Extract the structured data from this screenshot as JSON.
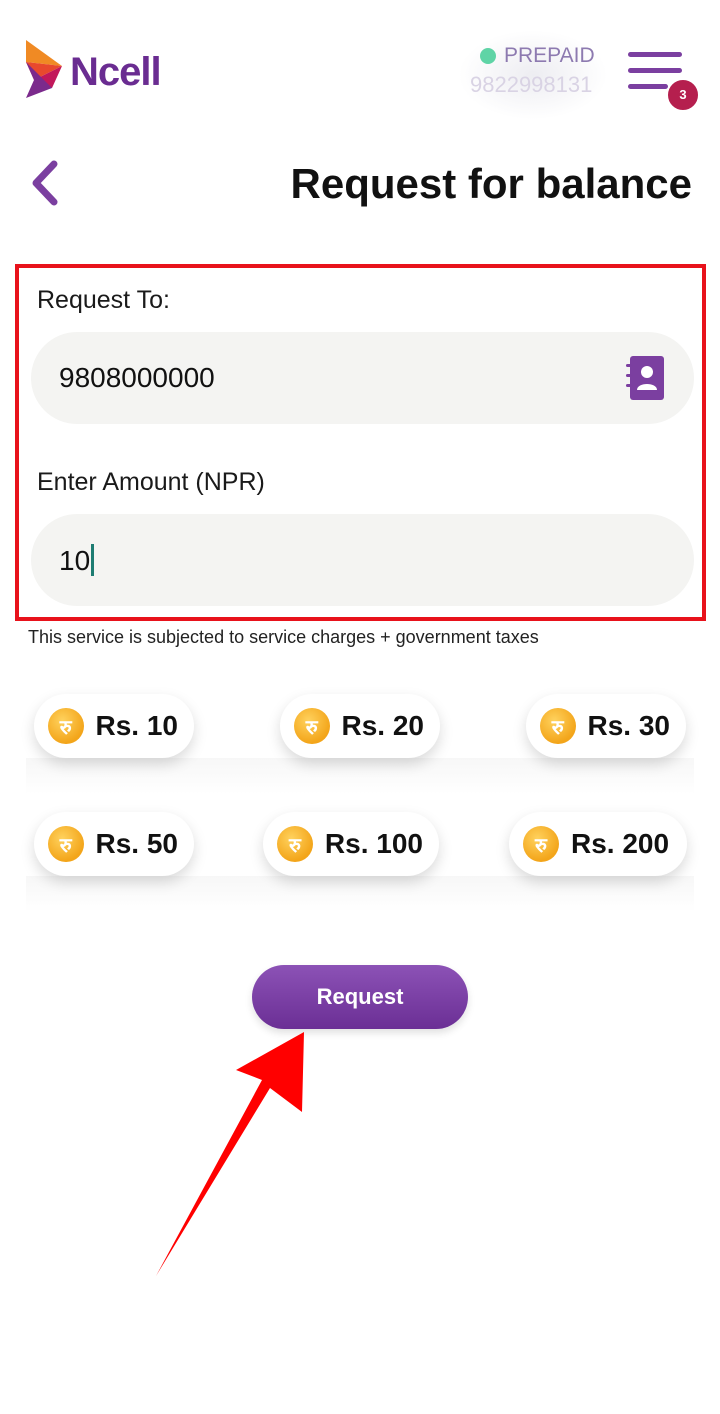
{
  "header": {
    "brand": "Ncell",
    "account_type": "PREPAID",
    "account_number": "9822998131",
    "menu_badge": "3",
    "colors": {
      "brand": "#6a2c91",
      "status_dot": "#5fd4a6",
      "badge": "#b51f4e"
    }
  },
  "page": {
    "title": "Request for balance"
  },
  "form": {
    "request_to_label": "Request To:",
    "request_to_value": "9808000000",
    "amount_label": "Enter Amount (NPR)",
    "amount_value": "10"
  },
  "note": "This service is subjected to service charges + government taxes",
  "amount_chips": [
    {
      "label": "Rs. 10",
      "icon": "rupee-coin-icon"
    },
    {
      "label": "Rs. 20",
      "icon": "rupee-coin-icon"
    },
    {
      "label": "Rs. 30",
      "icon": "rupee-coin-icon"
    },
    {
      "label": "Rs. 50",
      "icon": "rupee-coin-icon"
    },
    {
      "label": "Rs. 100",
      "icon": "rupee-coin-icon"
    },
    {
      "label": "Rs. 200",
      "icon": "rupee-coin-icon"
    }
  ],
  "coin_glyph": "रु",
  "actions": {
    "request_label": "Request"
  },
  "annotations": {
    "highlight_color": "#e8121b",
    "arrow_color": "#ff0000"
  }
}
